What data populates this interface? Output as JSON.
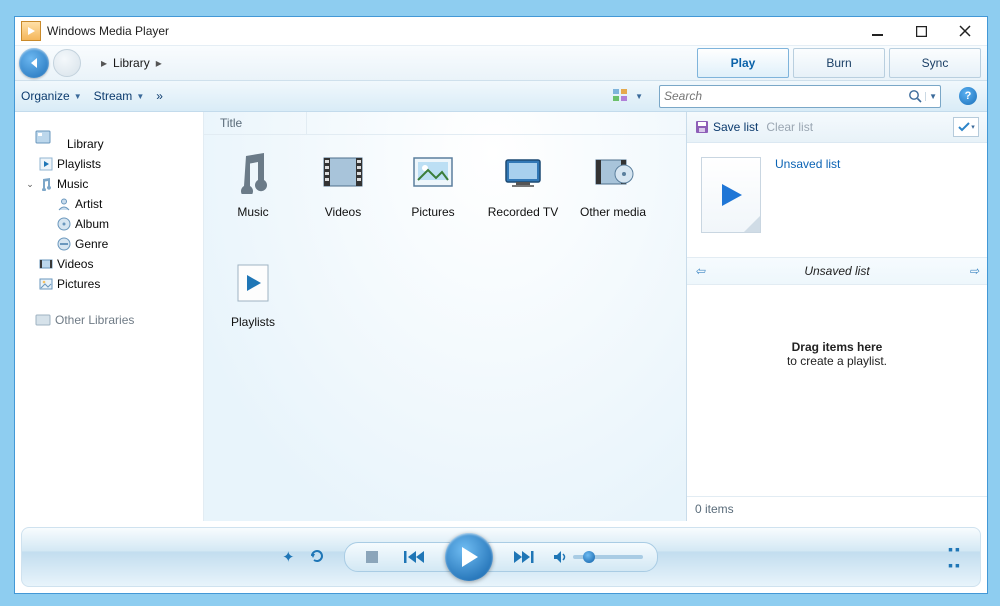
{
  "window": {
    "title": "Windows Media Player"
  },
  "breadcrumb": {
    "root_chev": "▸",
    "item1": "Library",
    "chev": "▸"
  },
  "tabs": {
    "play": "Play",
    "burn": "Burn",
    "sync": "Sync"
  },
  "toolbar": {
    "organize": "Organize",
    "stream": "Stream",
    "more": "»",
    "search_placeholder": "Search"
  },
  "tree": {
    "library": "Library",
    "playlists": "Playlists",
    "music": "Music",
    "artist": "Artist",
    "album": "Album",
    "genre": "Genre",
    "videos": "Videos",
    "pictures": "Pictures",
    "other_libraries": "Other Libraries"
  },
  "column": {
    "title": "Title"
  },
  "items": {
    "music": "Music",
    "videos": "Videos",
    "pictures": "Pictures",
    "recorded_tv": "Recorded TV",
    "other_media": "Other media",
    "playlists": "Playlists"
  },
  "right": {
    "save_list": "Save list",
    "clear_list": "Clear list",
    "playlist_name": "Unsaved list",
    "sub_header": "Unsaved list",
    "drag_title": "Drag items here",
    "drag_sub": "to create a playlist.",
    "count": "0 items"
  }
}
